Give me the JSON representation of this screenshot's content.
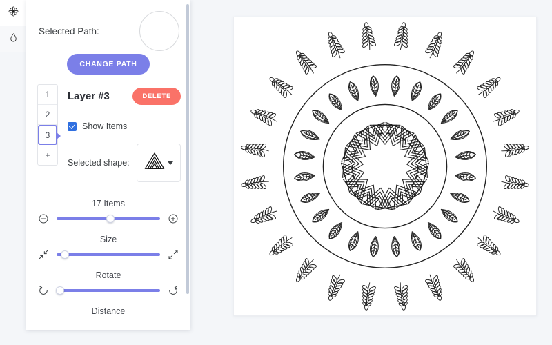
{
  "toolbar": {
    "items": [
      {
        "name": "mandala-tool",
        "icon": "mandala-icon",
        "active": true
      },
      {
        "name": "droplet-tool",
        "icon": "droplet-icon",
        "active": false
      }
    ]
  },
  "panel": {
    "path": {
      "label": "Selected Path:",
      "preview_shape": "circle",
      "change_button": "CHANGE PATH"
    },
    "layer_tabs": [
      "1",
      "2",
      "3",
      "+"
    ],
    "selected_tab": "3",
    "layer": {
      "title": "Layer #3",
      "delete_button": "DELETE",
      "show_items_label": "Show Items",
      "show_items_checked": true,
      "shape_label": "Selected shape:",
      "shape_icon": "nested-triangle-icon"
    },
    "sliders": [
      {
        "name": "items",
        "caption": "17 Items",
        "value_pct": 52,
        "icon_left": "minus-circle-icon",
        "icon_right": "plus-circle-icon"
      },
      {
        "name": "size",
        "caption": "Size",
        "value_pct": 8,
        "icon_left": "shrink-icon",
        "icon_right": "expand-icon"
      },
      {
        "name": "rotate",
        "caption": "Rotate",
        "value_pct": 3,
        "icon_left": "rotate-ccw-icon",
        "icon_right": "rotate-cw-icon"
      }
    ],
    "distance_caption": "Distance"
  },
  "canvas": {
    "title": "mandala-artwork",
    "rings": [
      {
        "name": "outer-branch-ring",
        "shape": "branch-sprig",
        "count": 24,
        "radius": 188
      },
      {
        "name": "middle-leaf-ring",
        "shape": "leaf",
        "count": 24,
        "radius": 118
      },
      {
        "name": "inner-triangle-ring",
        "shape": "nested-triangle",
        "count": 17,
        "radius": 58
      }
    ],
    "guide_circles": [
      148,
      90
    ],
    "dashed_circle_radius": 48
  },
  "colors": {
    "accent": "#7b7fe8",
    "danger": "#fa7268",
    "checkbox": "#2f6fe0",
    "background": "#f4f6f9",
    "panel": "#ffffff",
    "ink": "#222222"
  }
}
